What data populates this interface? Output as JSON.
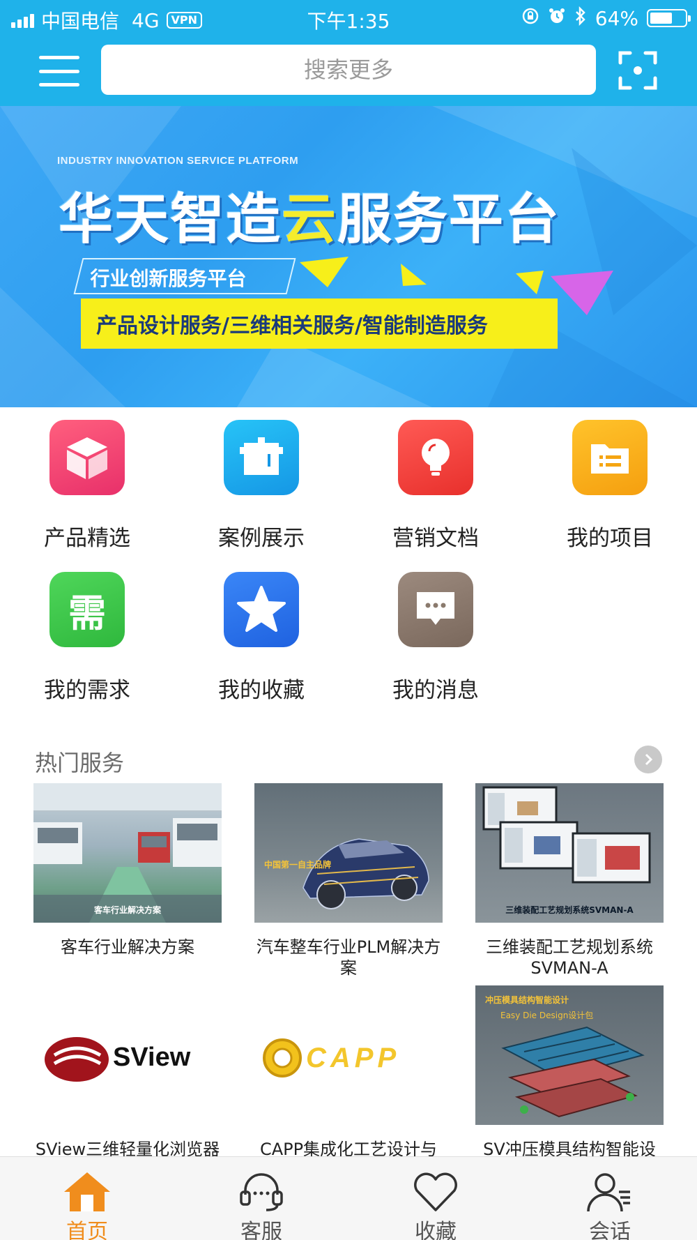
{
  "status_bar": {
    "carrier": "中国电信",
    "network": "4G",
    "vpn": "VPN",
    "time": "下午1:35",
    "battery": "64%",
    "battery_level": 0.64
  },
  "header": {
    "search_placeholder": "搜索更多"
  },
  "banner": {
    "eyebrow": "INDUSTRY INNOVATION SERVICE PLATFORM",
    "title_a": "华天智造",
    "title_b": "云",
    "title_c": "服务平台",
    "subtitle": "行业创新服务平台",
    "services": "产品设计服务/三维相关服务/智能制造服务"
  },
  "quick_menu": [
    {
      "label": "产品精选",
      "icon": "cube-icon"
    },
    {
      "label": "案例展示",
      "icon": "case-icon"
    },
    {
      "label": "营销文档",
      "icon": "lightbulb-icon"
    },
    {
      "label": "我的项目",
      "icon": "folder-icon"
    },
    {
      "label": "我的需求",
      "icon": "demand-icon",
      "glyph": "需"
    },
    {
      "label": "我的收藏",
      "icon": "star-icon"
    },
    {
      "label": "我的消息",
      "icon": "message-icon"
    }
  ],
  "hot_services": {
    "title": "热门服务",
    "items": [
      {
        "title": "客车行业解决方案",
        "thumb_caption": "客车行业解决方案"
      },
      {
        "title": "汽车整车行业PLM解决方案",
        "thumb_caption": "中国第一自主品牌"
      },
      {
        "title": "三维装配工艺规划系统SVMAN-A",
        "thumb_caption": "三维装配工艺规划系统SVMAN-A"
      },
      {
        "title": "SView三维轻量化浏览器",
        "thumb_caption": "",
        "logo_text": "SView"
      },
      {
        "title": "CAPP集成化工艺设计与",
        "thumb_caption": "",
        "logo_text": "CAPP"
      },
      {
        "title": "SV冲压模具结构智能设",
        "thumb_caption": "冲压模具结构智能设计",
        "thumb_caption2": "Easy Die Design设计包"
      }
    ]
  },
  "tabbar": [
    {
      "label": "首页",
      "icon": "home-icon",
      "active": true
    },
    {
      "label": "客服",
      "icon": "headset-icon",
      "active": false
    },
    {
      "label": "收藏",
      "icon": "heart-icon",
      "active": false
    },
    {
      "label": "会话",
      "icon": "user-chat-icon",
      "active": false
    }
  ],
  "colors": {
    "header_blue": "#1fb2ea",
    "accent_orange": "#f08d1d",
    "banner_yellow": "#f7ef1a"
  }
}
